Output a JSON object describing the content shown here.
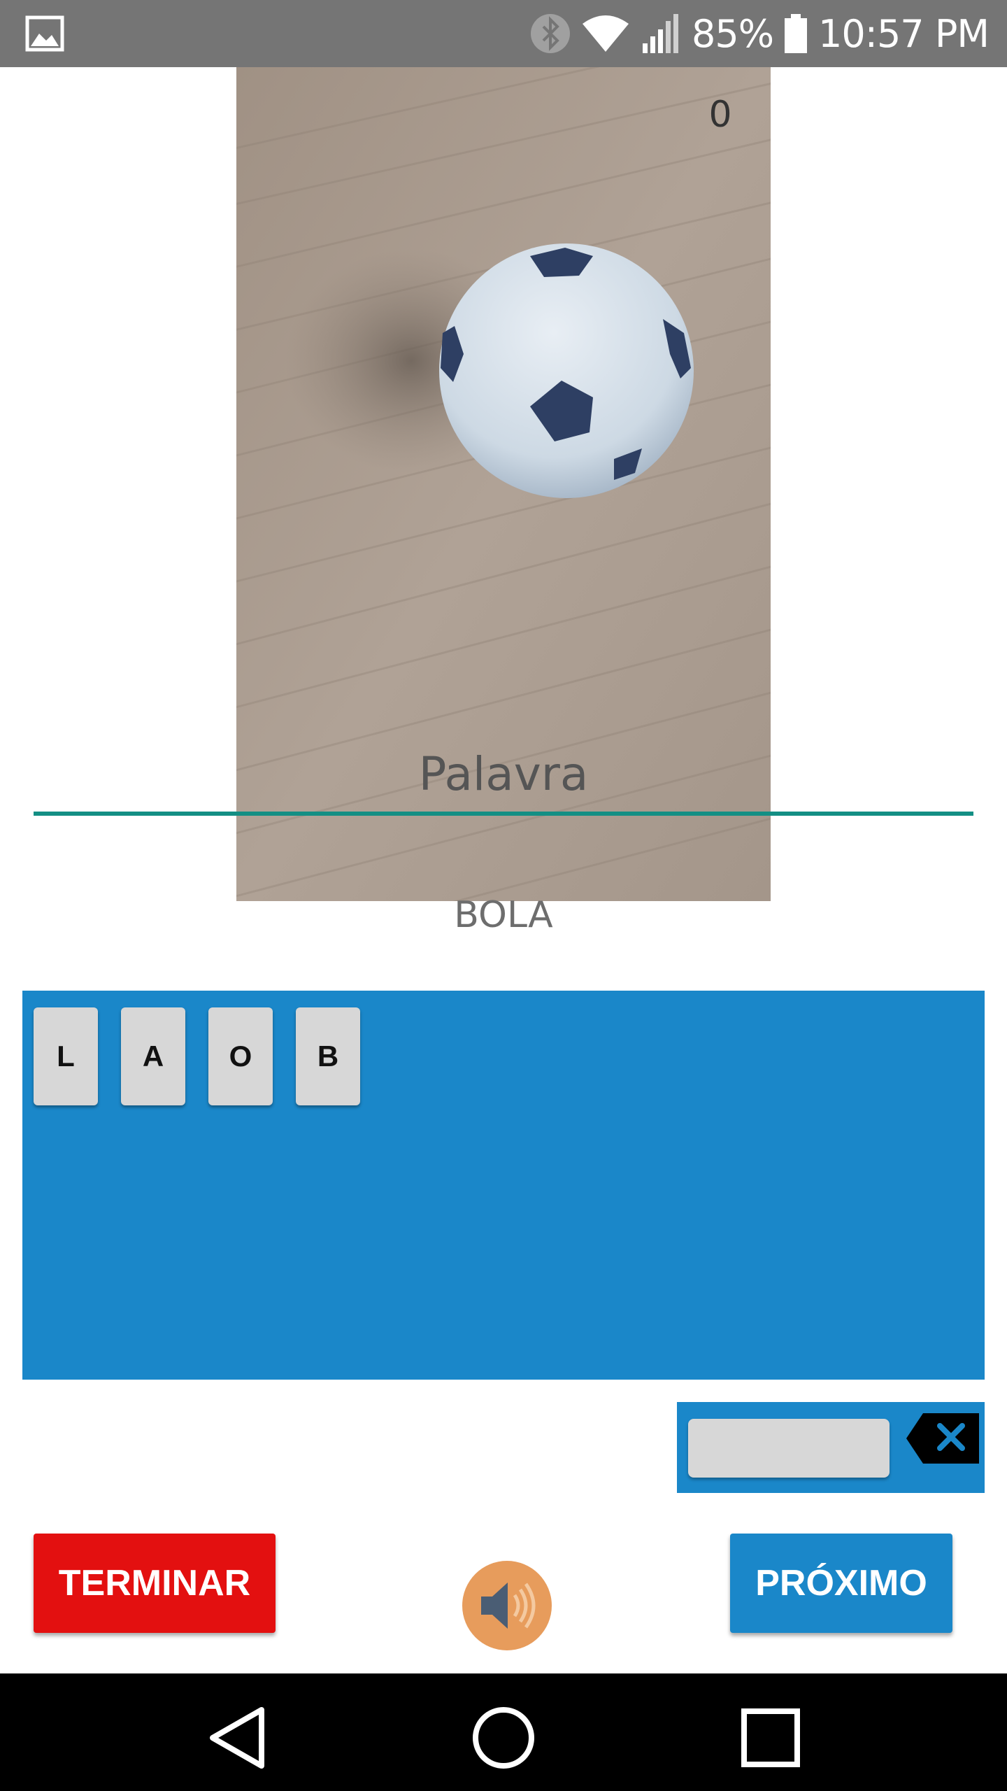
{
  "status_bar": {
    "battery": "85%",
    "time": "10:57 PM",
    "icons": [
      "gallery-icon",
      "bluetooth-icon",
      "wifi-icon",
      "signal-icon",
      "battery-icon"
    ]
  },
  "game": {
    "score": "0",
    "word_hint": "Palavra",
    "answer": "BOLA",
    "letters": [
      "L",
      "A",
      "O",
      "B"
    ],
    "input_value": ""
  },
  "buttons": {
    "terminar": "TERMINAR",
    "proximo": "PRÓXIMO"
  },
  "icons": {
    "speaker": "speaker-icon",
    "backspace": "backspace-icon",
    "nav": [
      "back-icon",
      "home-icon",
      "recents-icon"
    ]
  },
  "colors": {
    "status_bar": "#757575",
    "accent_blue": "#1a87c9",
    "terminar_red": "#e31010",
    "underline_teal": "#138f84",
    "tile_gray": "#d7d7d7"
  }
}
